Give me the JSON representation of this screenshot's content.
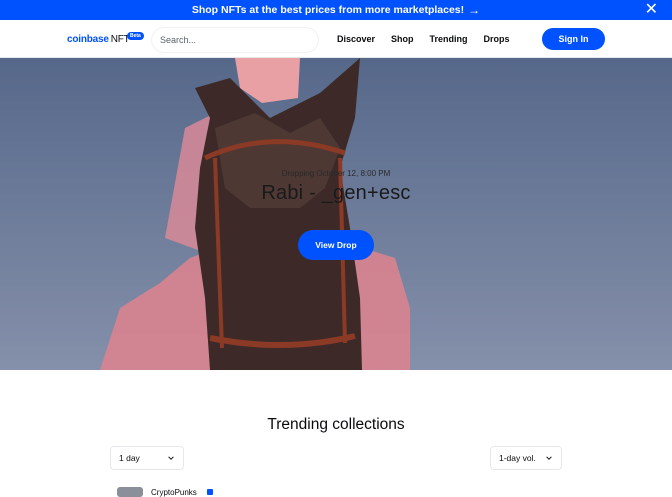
{
  "banner": {
    "text": "Shop NFTs at the best prices from more marketplaces!",
    "arrow_icon": "arrow-right-icon",
    "close_icon": "close-icon"
  },
  "nav": {
    "logo_text": "coinbase",
    "logo_suffix": "NFT",
    "beta_label": "Beta",
    "search_placeholder": "Search...",
    "links": [
      "Discover",
      "Shop",
      "Trending",
      "Drops"
    ],
    "signin_label": "Sign In"
  },
  "hero": {
    "date": "Dropping October 12, 8:00 PM",
    "title": "Rabi - _gen+esc",
    "button_label": "View Drop"
  },
  "trending": {
    "title": "Trending collections",
    "time_filter": "1 day",
    "sort_filter": "1-day vol.",
    "first_row_name": "CryptoPunks"
  },
  "colors": {
    "accent": "#0052ff",
    "text": "#0a0b0d",
    "border": "#e6e8eb"
  }
}
